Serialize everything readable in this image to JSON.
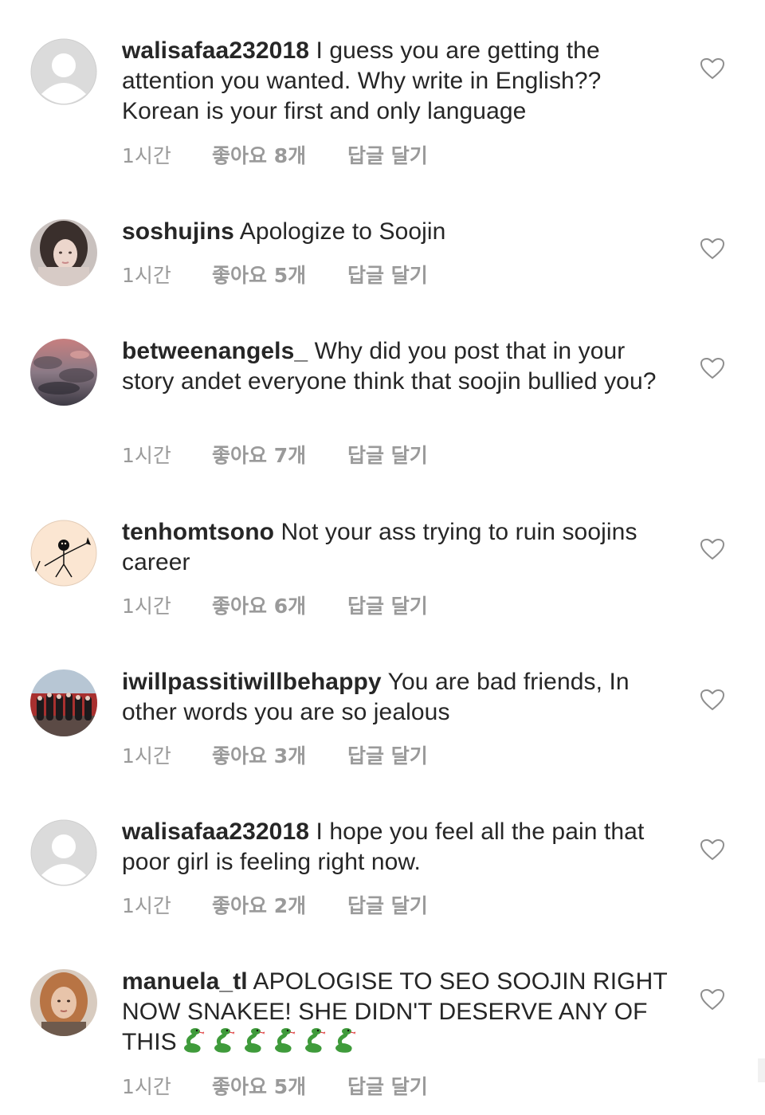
{
  "comments": [
    {
      "avatar": "default-avatar",
      "username": "walisafaa232018",
      "text": "I guess you are getting the attention you wanted. Why write in English?? Korean is your first and only language",
      "time": "1시간",
      "likes": "좋아요 8개",
      "reply": "답글 달기",
      "emoji": []
    },
    {
      "avatar": "photo-girl-avatar",
      "username": "soshujins",
      "text": "Apologize to Soojin",
      "time": "1시간",
      "likes": "좋아요 5개",
      "reply": "답글 달기",
      "emoji": []
    },
    {
      "avatar": "cloudy-sky-avatar",
      "username": "betweenangels_",
      "text": "Why did you post that in your story andet everyone think that soojin bullied you?",
      "time": "1시간",
      "likes": "좋아요 7개",
      "reply": "답글 달기",
      "emoji": []
    },
    {
      "avatar": "stick-figure-avatar",
      "username": "tenhomtsono",
      "text": "Not your ass trying to ruin soojins career",
      "time": "1시간",
      "likes": "좋아요 6개",
      "reply": "답글 달기",
      "emoji": []
    },
    {
      "avatar": "group-photo-avatar",
      "username": "iwillpassitiwillbehappy",
      "text": "You are bad friends, In other words you are so jealous",
      "time": "1시간",
      "likes": "좋아요 3개",
      "reply": "답글 달기",
      "emoji": []
    },
    {
      "avatar": "default-avatar",
      "username": "walisafaa232018",
      "text": "I hope you feel all the pain that poor girl is feeling right now.",
      "time": "1시간",
      "likes": "좋아요 2개",
      "reply": "답글 달기",
      "emoji": []
    },
    {
      "avatar": "photo-woman-avatar",
      "username": "manuela_tl",
      "text": "APOLOGISE TO SEO SOOJIN RIGHT NOW SNAKEE! SHE DIDN'T DESERVE ANY OF THIS",
      "time": "1시간",
      "likes": "좋아요 5개",
      "reply": "답글 달기",
      "emoji": [
        "snake",
        "snake",
        "snake",
        "snake",
        "snake",
        "snake"
      ]
    }
  ],
  "colors": {
    "text": "#262626",
    "meta": "#9a9a9a",
    "heart_outline": "#8e8e8e",
    "default_avatar_bg": "#dbdbdb",
    "snake_green": "#3f9b3b"
  }
}
